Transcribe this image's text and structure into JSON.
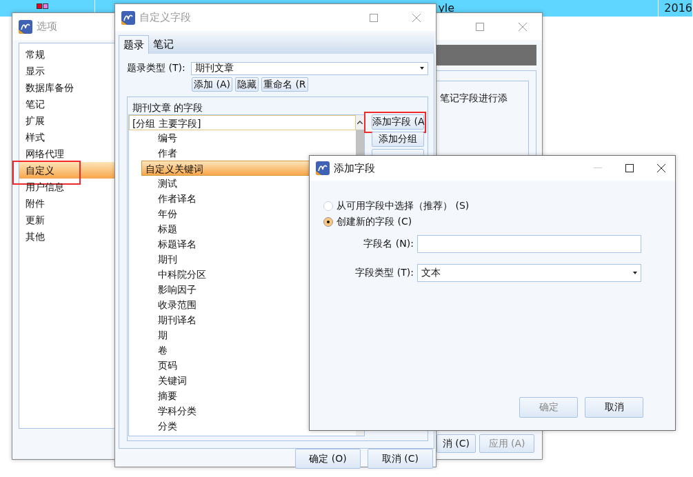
{
  "background": {
    "markers": [
      {
        "color": "#e8001c"
      },
      {
        "color": "#e47de6"
      }
    ],
    "texts": [
      "yle",
      "2016"
    ]
  },
  "options_window": {
    "title": "选项",
    "sidebar": [
      {
        "label": "常规",
        "selected": false,
        "highlighted": false
      },
      {
        "label": "显示",
        "selected": false,
        "highlighted": false
      },
      {
        "label": "数据库备份",
        "selected": false,
        "highlighted": false
      },
      {
        "label": "笔记",
        "selected": false,
        "highlighted": false
      },
      {
        "label": "扩展",
        "selected": false,
        "highlighted": false
      },
      {
        "label": "样式",
        "selected": false,
        "highlighted": false
      },
      {
        "label": "网络代理",
        "selected": false,
        "highlighted": false
      },
      {
        "label": "自定义",
        "selected": true,
        "highlighted": true
      },
      {
        "label": "用户信息",
        "selected": false,
        "highlighted": false
      },
      {
        "label": "附件",
        "selected": false,
        "highlighted": false
      },
      {
        "label": "更新",
        "selected": false,
        "highlighted": false
      },
      {
        "label": "其他",
        "selected": false,
        "highlighted": false
      }
    ],
    "panel_text": "笔记字段进行添",
    "buttons": [
      {
        "label": "消 (C)",
        "disabled": false
      },
      {
        "label": "应用 (A)",
        "disabled": true
      }
    ]
  },
  "fields_window": {
    "title": "自定义字段",
    "tabs": [
      {
        "label": "题录",
        "selected": true
      },
      {
        "label": "笔记",
        "selected": false
      }
    ],
    "record_type": {
      "label": "题录类型 (T):",
      "value": "期刊文章"
    },
    "type_buttons": [
      "添加 (A)",
      "隐藏",
      "重命名 (R"
    ],
    "group": {
      "title": "期刊文章 的字段",
      "header": "[分组 主要字段]",
      "items": [
        {
          "label": "编号",
          "selected": false
        },
        {
          "label": "作者",
          "selected": false
        },
        {
          "label": "自定义关键词",
          "selected": true
        },
        {
          "label": "测试",
          "selected": false
        },
        {
          "label": "作者译名",
          "selected": false
        },
        {
          "label": "年份",
          "selected": false
        },
        {
          "label": "标题",
          "selected": false
        },
        {
          "label": "标题译名",
          "selected": false
        },
        {
          "label": "期刊",
          "selected": false
        },
        {
          "label": "中科院分区",
          "selected": false
        },
        {
          "label": "影响因子",
          "selected": false
        },
        {
          "label": "收录范围",
          "selected": false
        },
        {
          "label": "期刊译名",
          "selected": false
        },
        {
          "label": "期",
          "selected": false
        },
        {
          "label": "卷",
          "selected": false
        },
        {
          "label": "页码",
          "selected": false
        },
        {
          "label": "关键词",
          "selected": false
        },
        {
          "label": "摘要",
          "selected": false
        },
        {
          "label": "学科分类",
          "selected": false
        },
        {
          "label": "分类",
          "selected": false
        }
      ]
    },
    "side_buttons": [
      {
        "label": "添加字段 (A",
        "highlighted": true
      },
      {
        "label": "添加分组",
        "highlighted": false
      }
    ],
    "buttons": [
      "确定 (O)",
      "取消 (C)"
    ]
  },
  "add_dialog": {
    "title": "添加字段",
    "options": [
      {
        "label": "从可用字段中选择（推荐） (S)",
        "selected": false
      },
      {
        "label": "创建新的字段 (C)",
        "selected": true
      }
    ],
    "name_field": {
      "label": "字段名 (N):"
    },
    "type_field": {
      "label": "字段类型 (T):",
      "value": "文本"
    },
    "buttons": [
      {
        "label": "确定",
        "disabled": true
      },
      {
        "label": "取消",
        "disabled": false
      }
    ]
  }
}
